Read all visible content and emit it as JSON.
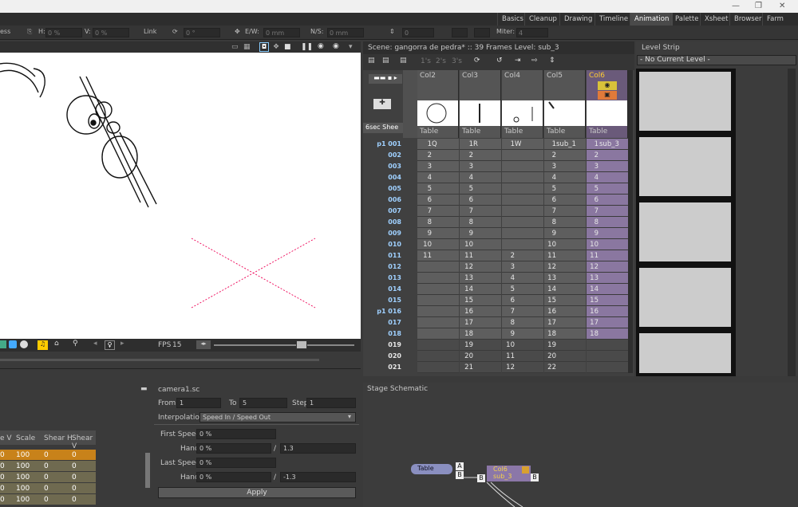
{
  "rooms": [
    "Basics",
    "Cleanup",
    "Drawing",
    "Timeline",
    "Animation",
    "Palette",
    "Xsheet",
    "Browser",
    "Farm"
  ],
  "active_room": "Animation",
  "tool_options": {
    "ess": "ess",
    "h_label": "H:",
    "h_value": "0 %",
    "v_label": "V:",
    "v_value": "0 %",
    "link": "Link",
    "rot_value": "0 °",
    "ew_label": "E/W:",
    "ew_value": "0 mm",
    "ns_label": "N/S:",
    "ns_value": "0 mm",
    "z_value": "0",
    "miter_label": "Miter:",
    "miter_value": "4"
  },
  "viewer": {
    "fps_label": "FPS",
    "fps_value": "15"
  },
  "xsheet": {
    "scene_info": "Scene: gangorra de pedra*  ::  39 Frames  Level: sub_3",
    "toggles": [
      "1's",
      "2's",
      "3's"
    ],
    "sheet_label": "6sec Shee",
    "columns": [
      {
        "name": "Col2",
        "pegbar": "Table"
      },
      {
        "name": "Col3",
        "pegbar": "Table"
      },
      {
        "name": "Col4",
        "pegbar": "Table"
      },
      {
        "name": "Col5",
        "pegbar": "Table"
      },
      {
        "name": "Col6",
        "pegbar": "Table"
      }
    ],
    "rows": [
      {
        "n": "p1 001",
        "c": [
          "1",
          "Q",
          "1",
          "R",
          "1",
          "W",
          "1",
          "sub_1",
          "1",
          "sub_3",
          "1"
        ]
      },
      {
        "n": "002",
        "c": [
          "2",
          "",
          "2",
          "",
          "",
          "",
          "2",
          "",
          "2",
          "",
          "2"
        ]
      },
      {
        "n": "003",
        "c": [
          "3",
          "",
          "3",
          "",
          "",
          "",
          "3",
          "",
          "3",
          "",
          "3"
        ]
      },
      {
        "n": "004",
        "c": [
          "4",
          "",
          "4",
          "",
          "",
          "",
          "4",
          "",
          "4",
          "",
          "4"
        ]
      },
      {
        "n": "005",
        "c": [
          "5",
          "",
          "5",
          "",
          "",
          "",
          "5",
          "",
          "5",
          "",
          "5"
        ]
      },
      {
        "n": "006",
        "c": [
          "6",
          "",
          "6",
          "",
          "",
          "",
          "6",
          "",
          "6",
          "",
          "6"
        ]
      },
      {
        "n": "007",
        "c": [
          "7",
          "",
          "7",
          "",
          "",
          "",
          "7",
          "",
          "7",
          "",
          "7"
        ]
      },
      {
        "n": "008",
        "c": [
          "8",
          "",
          "8",
          "",
          "",
          "",
          "8",
          "",
          "8",
          "",
          "8"
        ]
      },
      {
        "n": "009",
        "c": [
          "9",
          "",
          "9",
          "",
          "",
          "",
          "9",
          "",
          "9",
          "",
          "9"
        ]
      },
      {
        "n": "010",
        "c": [
          "10",
          "",
          "10",
          "",
          "",
          "",
          "10",
          "",
          "10",
          "",
          "10"
        ]
      },
      {
        "n": "011",
        "c": [
          "11",
          "",
          "11",
          "",
          "2",
          "",
          "11",
          "",
          "11",
          "",
          "11"
        ]
      },
      {
        "n": "012",
        "c": [
          "",
          "",
          "12",
          "",
          "3",
          "",
          "12",
          "",
          "12",
          "",
          "12"
        ]
      },
      {
        "n": "013",
        "c": [
          "",
          "",
          "13",
          "",
          "4",
          "",
          "13",
          "",
          "13",
          "",
          "13"
        ]
      },
      {
        "n": "014",
        "c": [
          "",
          "",
          "14",
          "",
          "5",
          "",
          "14",
          "",
          "14",
          "",
          "14"
        ]
      },
      {
        "n": "015",
        "c": [
          "",
          "",
          "15",
          "",
          "6",
          "",
          "15",
          "",
          "15",
          "",
          "15"
        ]
      },
      {
        "n": "p1 016",
        "c": [
          "",
          "",
          "16",
          "",
          "7",
          "",
          "16",
          "",
          "16",
          "",
          "16"
        ]
      },
      {
        "n": "017",
        "c": [
          "",
          "",
          "17",
          "",
          "8",
          "",
          "17",
          "",
          "17",
          "",
          "17"
        ]
      },
      {
        "n": "018",
        "c": [
          "",
          "",
          "18",
          "",
          "9",
          "",
          "18",
          "",
          "18",
          "",
          "18"
        ]
      },
      {
        "n": "019",
        "c": [
          "",
          "",
          "19",
          "",
          "10",
          "",
          "19",
          "",
          "",
          "",
          " "
        ]
      },
      {
        "n": "020",
        "c": [
          "",
          "",
          "20",
          "",
          "11",
          "",
          "20",
          "",
          "",
          "",
          " "
        ]
      },
      {
        "n": "021",
        "c": [
          "",
          "",
          "21",
          "",
          "12",
          "",
          "22",
          "",
          "",
          "",
          " "
        ]
      }
    ]
  },
  "level_strip": {
    "title": "Level Strip",
    "dropdown": "- No Current Level -"
  },
  "fx": {
    "headers": [
      "e V",
      "Scale",
      "Shear H",
      "Shear V"
    ],
    "rows": [
      [
        "0",
        "100",
        "0",
        "0"
      ],
      [
        "0",
        "100",
        "0",
        "0"
      ],
      [
        "0",
        "100",
        "0",
        "0"
      ],
      [
        "0",
        "100",
        "0",
        "0"
      ],
      [
        "0",
        "100",
        "0",
        "0"
      ]
    ]
  },
  "interp": {
    "camera": "camera1.sc",
    "from_label": "From",
    "from_value": "1",
    "to_label": "To",
    "to_value": "5",
    "step_label": "Step",
    "step_value": "1",
    "interp_label": "Interpolation:",
    "interp_value": "Speed In / Speed Out",
    "first_speed_label": "First Speed:",
    "first_speed_value": "0 %",
    "handle1_label": "Handle:",
    "handle1_value": "0 %",
    "handle1_b": "1.3",
    "last_speed_label": "Last Speed:",
    "last_speed_value": "0 %",
    "handle2_label": "Handle:",
    "handle2_value": "0 %",
    "handle2_b": "-1.3",
    "apply": "Apply"
  },
  "schematic": {
    "title": "Stage Schematic",
    "table_node": "Table",
    "col_node": "Col6",
    "col_sub": "sub_3",
    "port_a": "A",
    "port_b": "B"
  }
}
